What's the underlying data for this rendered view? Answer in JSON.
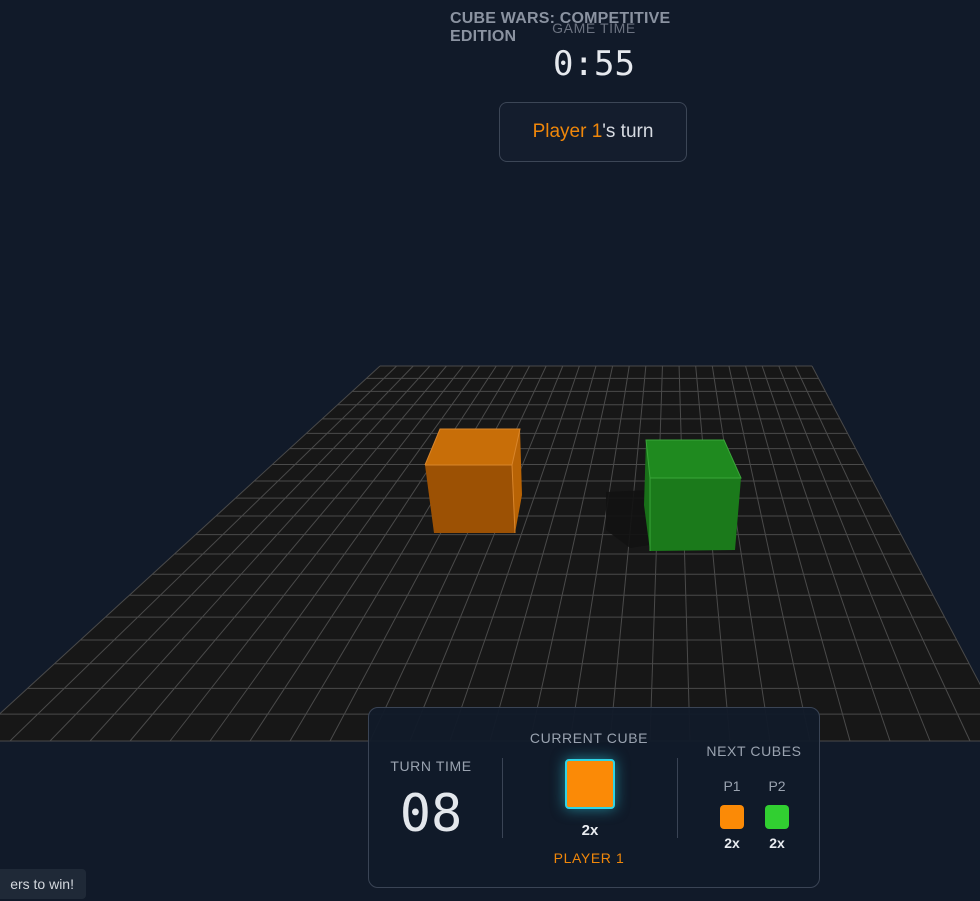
{
  "header": {
    "title": "CUBE WARS: COMPETITIVE EDITION",
    "game_time_label": "GAME TIME",
    "game_time": "0:55",
    "turn_player": "Player 1",
    "turn_suffix": "'s turn"
  },
  "board": {
    "grid_cols": 26,
    "grid_rows": 20,
    "cubes": [
      {
        "name": "orange-cube",
        "color": "#c56a05",
        "col": 8,
        "row": 9
      },
      {
        "name": "green-cube",
        "color": "#1b8a1b",
        "col": 16,
        "row": 10
      }
    ]
  },
  "hud": {
    "turn_time_label": "TURN TIME",
    "turn_time": "08",
    "current_cube_label": "CURRENT CUBE",
    "current_cube_color": "#fb8a06",
    "current_mult": "2x",
    "current_player": "PLAYER 1",
    "next_cubes_label": "NEXT CUBES",
    "next": [
      {
        "label": "P1",
        "color": "#fb8a06",
        "mult": "2x"
      },
      {
        "label": "P2",
        "color": "#31cf31",
        "mult": "2x"
      }
    ]
  },
  "toast": {
    "text": "ers to win!"
  }
}
